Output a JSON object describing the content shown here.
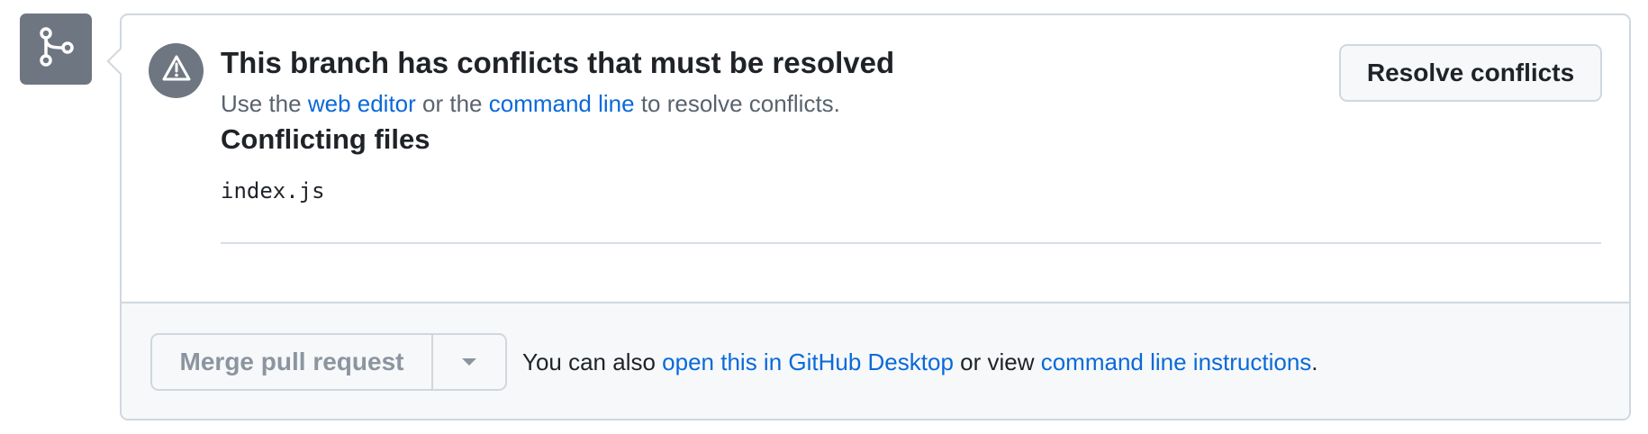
{
  "icons": {
    "branch": "git-branch-icon",
    "alert": "alert-triangle-icon",
    "dropdown": "triangle-down-icon"
  },
  "colors": {
    "accent_link": "#0969da",
    "icon_gray": "#6e7781",
    "border": "#d0d7de",
    "footer_bg": "#f6f8fa"
  },
  "conflict": {
    "title": "This branch has conflicts that must be resolved",
    "subtitle_prefix": "Use the ",
    "web_editor_link": "web editor",
    "subtitle_middle": " or the ",
    "command_line_link": "command line",
    "subtitle_suffix": " to resolve conflicts.",
    "resolve_button": "Resolve conflicts",
    "files_heading": "Conflicting files",
    "files": [
      "index.js"
    ]
  },
  "merge": {
    "merge_button": "Merge pull request",
    "text_prefix": "You can also ",
    "desktop_link": "open this in GitHub Desktop",
    "text_middle": " or view ",
    "instructions_link": "command line instructions",
    "text_suffix": "."
  }
}
